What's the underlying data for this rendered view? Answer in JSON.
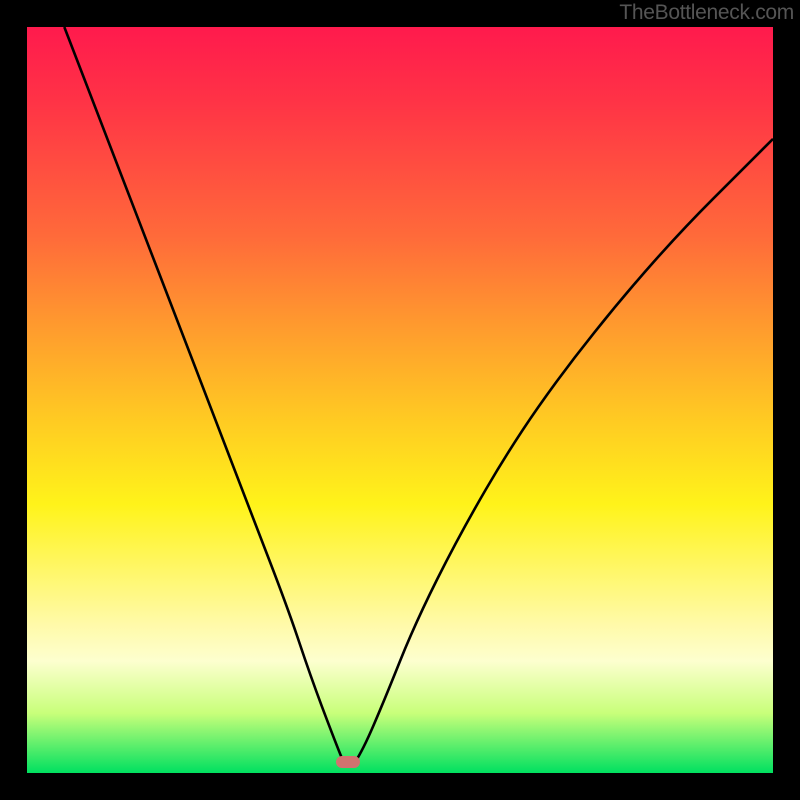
{
  "watermark": "TheBottleneck.com",
  "marker": {
    "x_frac": 0.43,
    "y_frac": 0.985
  },
  "chart_data": {
    "type": "line",
    "title": "",
    "xlabel": "",
    "ylabel": "",
    "xlim": [
      0,
      1
    ],
    "ylim": [
      0,
      1
    ],
    "series": [
      {
        "name": "curve",
        "x": [
          0.05,
          0.1,
          0.15,
          0.2,
          0.25,
          0.3,
          0.35,
          0.38,
          0.41,
          0.43,
          0.45,
          0.48,
          0.52,
          0.58,
          0.65,
          0.72,
          0.8,
          0.88,
          0.96,
          1.0
        ],
        "y": [
          1.0,
          0.87,
          0.74,
          0.61,
          0.48,
          0.35,
          0.22,
          0.13,
          0.05,
          0.0,
          0.03,
          0.1,
          0.2,
          0.32,
          0.44,
          0.54,
          0.64,
          0.73,
          0.81,
          0.85
        ]
      }
    ],
    "annotations": [
      {
        "type": "marker",
        "x": 0.43,
        "y": 0.0,
        "label": ""
      }
    ],
    "background_gradient_top_to_bottom": [
      "#ff1a4d",
      "#ffc823",
      "#fff31a",
      "#00e060"
    ]
  }
}
